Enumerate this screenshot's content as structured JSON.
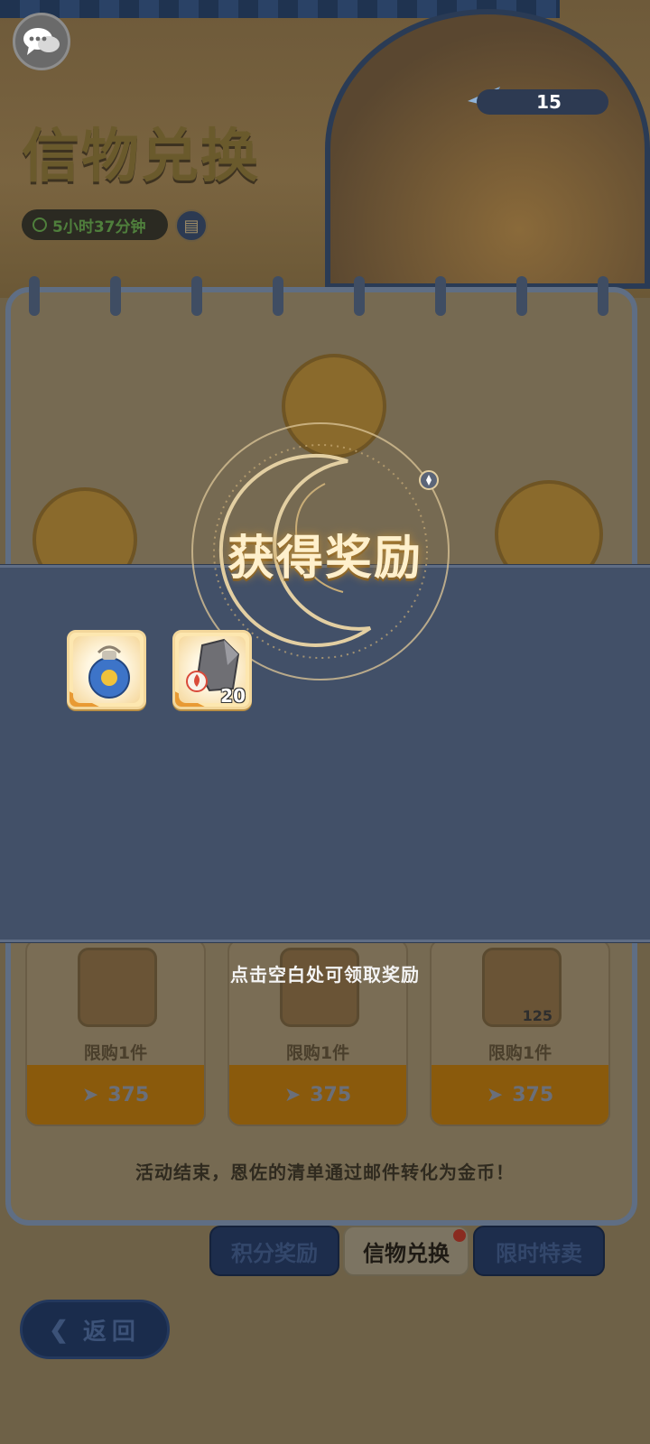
{
  "header": {
    "title": "信物兑换",
    "timer": "5小时37分钟",
    "currency_count": "15"
  },
  "shop": {
    "cards": [
      {
        "limit": "限购1件",
        "price": "375",
        "qty": ""
      },
      {
        "limit": "限购1件",
        "price": "375",
        "qty": ""
      },
      {
        "limit": "限购1件",
        "price": "375",
        "qty": "125"
      }
    ],
    "footer_note": "活动结束，恩佐的清单通过邮件转化为金币！"
  },
  "tabs": [
    {
      "label": "积分奖励"
    },
    {
      "label": "信物兑换"
    },
    {
      "label": "限时特卖"
    }
  ],
  "back_label": "返回",
  "popup": {
    "title": "获得奖励",
    "rewards": [
      {
        "icon": "blue-potion-bag-icon",
        "count": ""
      },
      {
        "icon": "gray-stone-fire-icon",
        "count": "20"
      }
    ],
    "hint": "点击空白处可领取奖励"
  },
  "colors": {
    "popup_band": "#425068",
    "accent_gold": "#e89a34",
    "title_glow": "#fff0cc"
  }
}
